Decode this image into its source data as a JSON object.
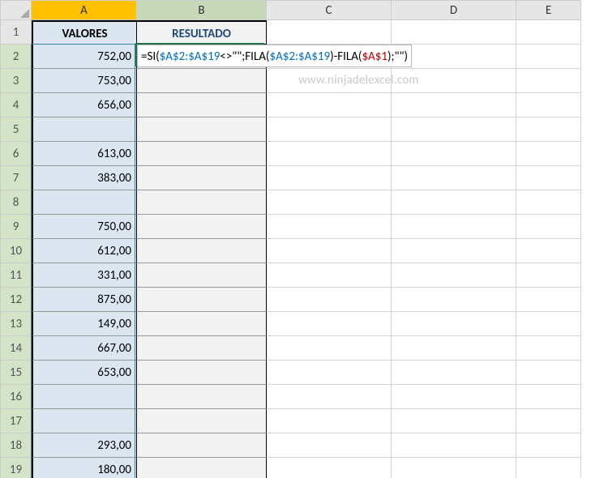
{
  "columns": [
    "A",
    "B",
    "C",
    "D",
    "E"
  ],
  "rowCount": 19,
  "headers": {
    "A": "VALORES",
    "B": "RESULTADO"
  },
  "colA": {
    "2": "752,00",
    "3": "753,00",
    "4": "656,00",
    "5": "",
    "6": "613,00",
    "7": "383,00",
    "8": "",
    "9": "750,00",
    "10": "612,00",
    "11": "331,00",
    "12": "875,00",
    "13": "149,00",
    "14": "667,00",
    "15": "653,00",
    "16": "",
    "17": "",
    "18": "293,00",
    "19": "180,00"
  },
  "activeCell": "B2",
  "formula": {
    "plain": "=SI($A$2:$A$19<>\"\";FILA($A$2:$A$19)-FILA($A$1);\"\")",
    "tokens": [
      {
        "t": "=SI(",
        "c": "black"
      },
      {
        "t": "$A$2:$A$19",
        "c": "blue"
      },
      {
        "t": "<>\"\";FILA(",
        "c": "black"
      },
      {
        "t": "$A$2:$A$19",
        "c": "blue"
      },
      {
        "t": ")-FILA(",
        "c": "black"
      },
      {
        "t": "$A$1",
        "c": "red"
      },
      {
        "t": ");\"\")",
        "c": "black"
      }
    ]
  },
  "watermark": "www.ninjadelexcel.com",
  "selectionRange": "A2:A19"
}
